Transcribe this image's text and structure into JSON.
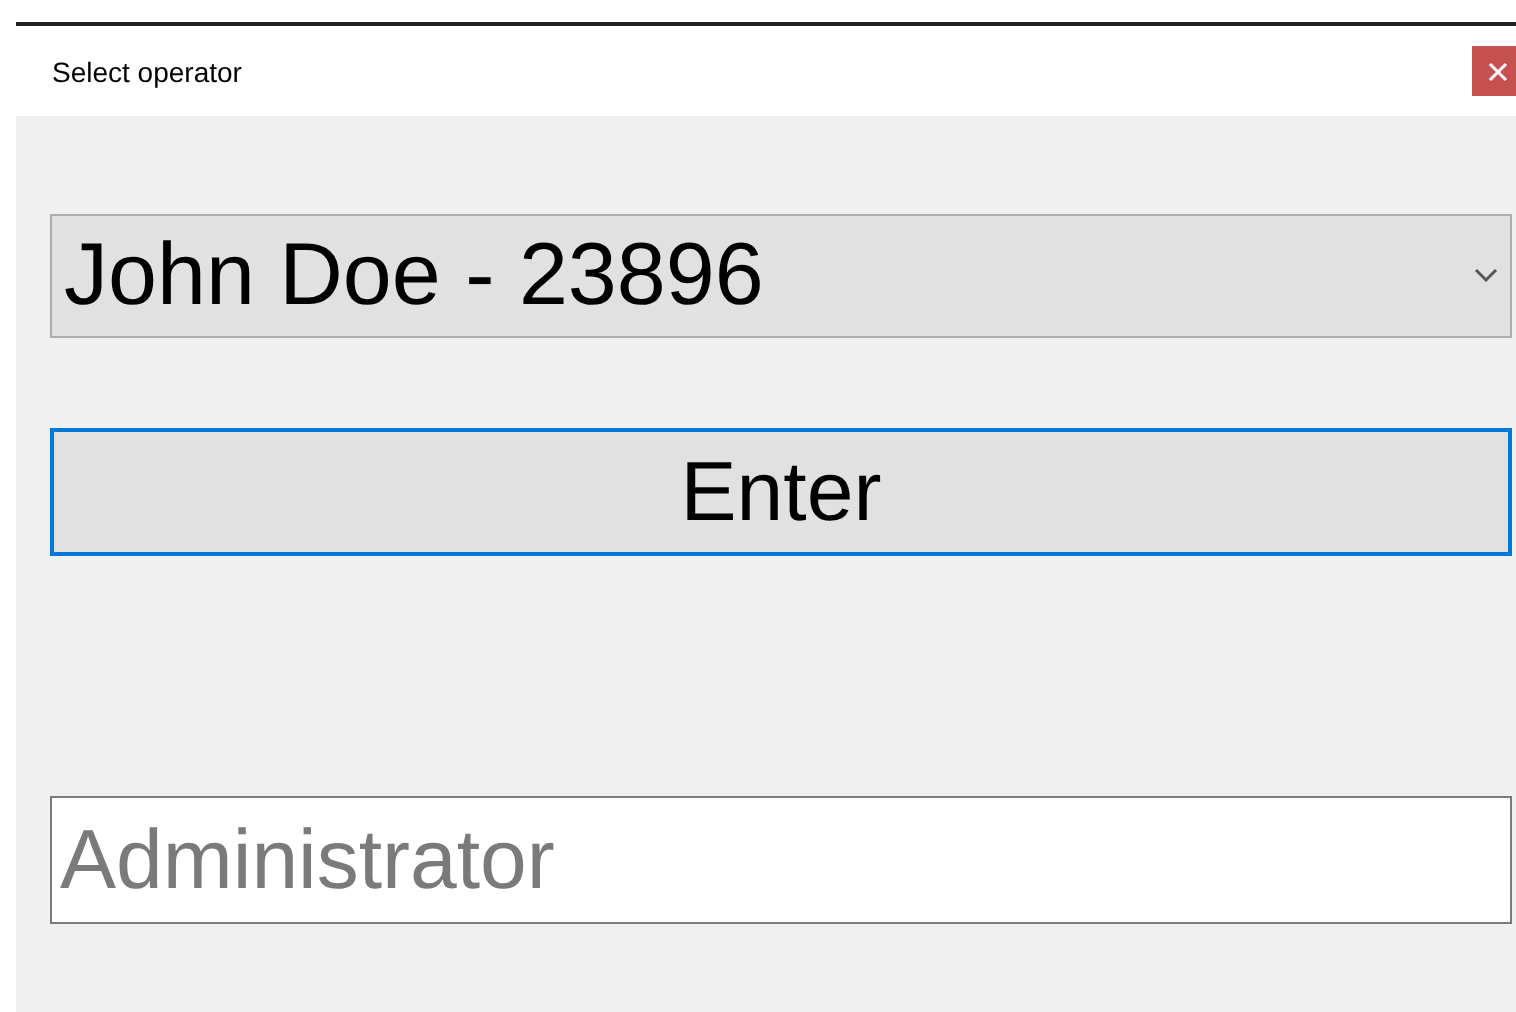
{
  "window": {
    "title": "Select operator"
  },
  "operator_select": {
    "value": "John Doe - 23896"
  },
  "enter_button": {
    "label": "Enter",
    "focused": true
  },
  "admin_field": {
    "placeholder": "Administrator"
  }
}
